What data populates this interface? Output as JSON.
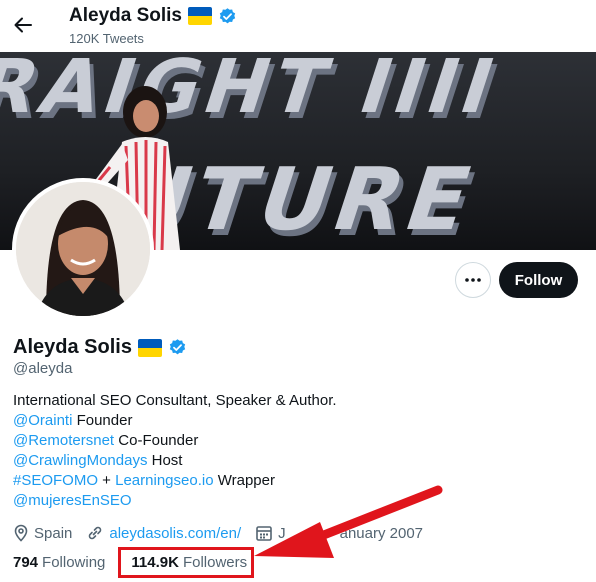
{
  "header": {
    "name": "Aleyda Solis",
    "tweet_count": "120K Tweets"
  },
  "profile": {
    "name": "Aleyda Solis",
    "handle": "@aleyda",
    "flag_colors": [
      "#005bbb",
      "#ffd500"
    ],
    "verified_color": "#1d9bf0"
  },
  "actions": {
    "more_icon": "more-horizontal-icon",
    "follow_label": "Follow"
  },
  "bio": {
    "line1": "International SEO Consultant, Speaker & Author.",
    "line2_link": "@Orainti",
    "line2_text": " Founder",
    "line3_link": "@Remotersnet",
    "line3_text": " Co-Founder",
    "line4_link": "@CrawlingMondays",
    "line4_text": " Host",
    "line5_link1": "#SEOFOMO",
    "line5_mid": " + ",
    "line5_link2": "Learningseo.io",
    "line5_text": " Wrapper",
    "line6_link": "@mujeresEnSEO"
  },
  "meta": {
    "location": "Spain",
    "website": "aleydasolis.com/en/",
    "joined": "J",
    "joined_tail": "anuary 2007"
  },
  "stats": {
    "following_count": "794",
    "following_label": "Following",
    "followers_count": "114.9K",
    "followers_label": "Followers"
  },
  "annotation": {
    "highlight_color": "#e0151c"
  }
}
